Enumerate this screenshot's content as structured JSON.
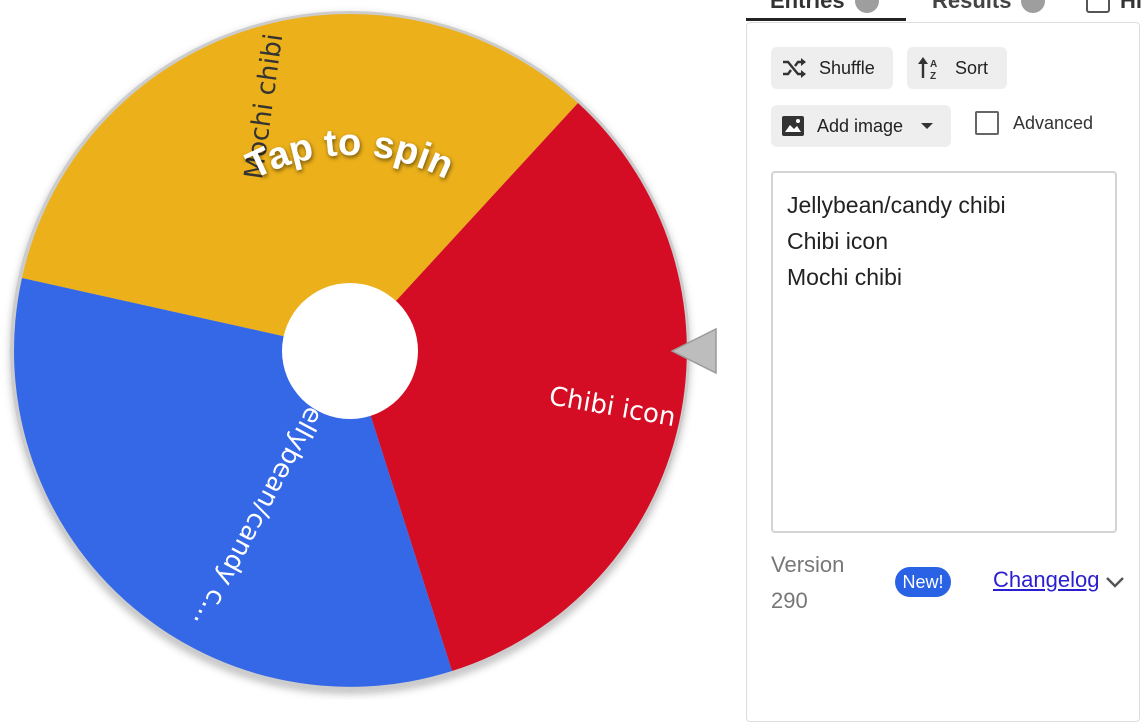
{
  "tabs": {
    "entries": "Entries",
    "results": "Results",
    "hide": "Hide"
  },
  "wheel": {
    "cta": "Tap to spin",
    "segments": [
      {
        "label": "Mochi chibi",
        "color": "#ecb01a"
      },
      {
        "label": "Chibi icon",
        "color": "#d40c24"
      },
      {
        "label": "Jellybean/candy c...",
        "color": "#3568e6"
      }
    ],
    "center_color": "#ffffff",
    "pointer_color": "#bdbdbd"
  },
  "toolbar": {
    "shuffle_label": "Shuffle",
    "sort_label": "Sort",
    "add_image_label": "Add image",
    "advanced_label": "Advanced"
  },
  "entries": {
    "lines": [
      "Jellybean/candy chibi",
      "Chibi icon",
      "Mochi chibi"
    ]
  },
  "footer": {
    "version_label": "Version",
    "version_number": "290",
    "new_badge": "New!",
    "changelog_label": "Changelog"
  },
  "icons": {
    "shuffle": "shuffle-icon",
    "sort": "sort-az-icon",
    "add_image": "image-icon",
    "dropdown": "caret-down-icon",
    "changelog_toggle": "chevron-down-icon"
  }
}
